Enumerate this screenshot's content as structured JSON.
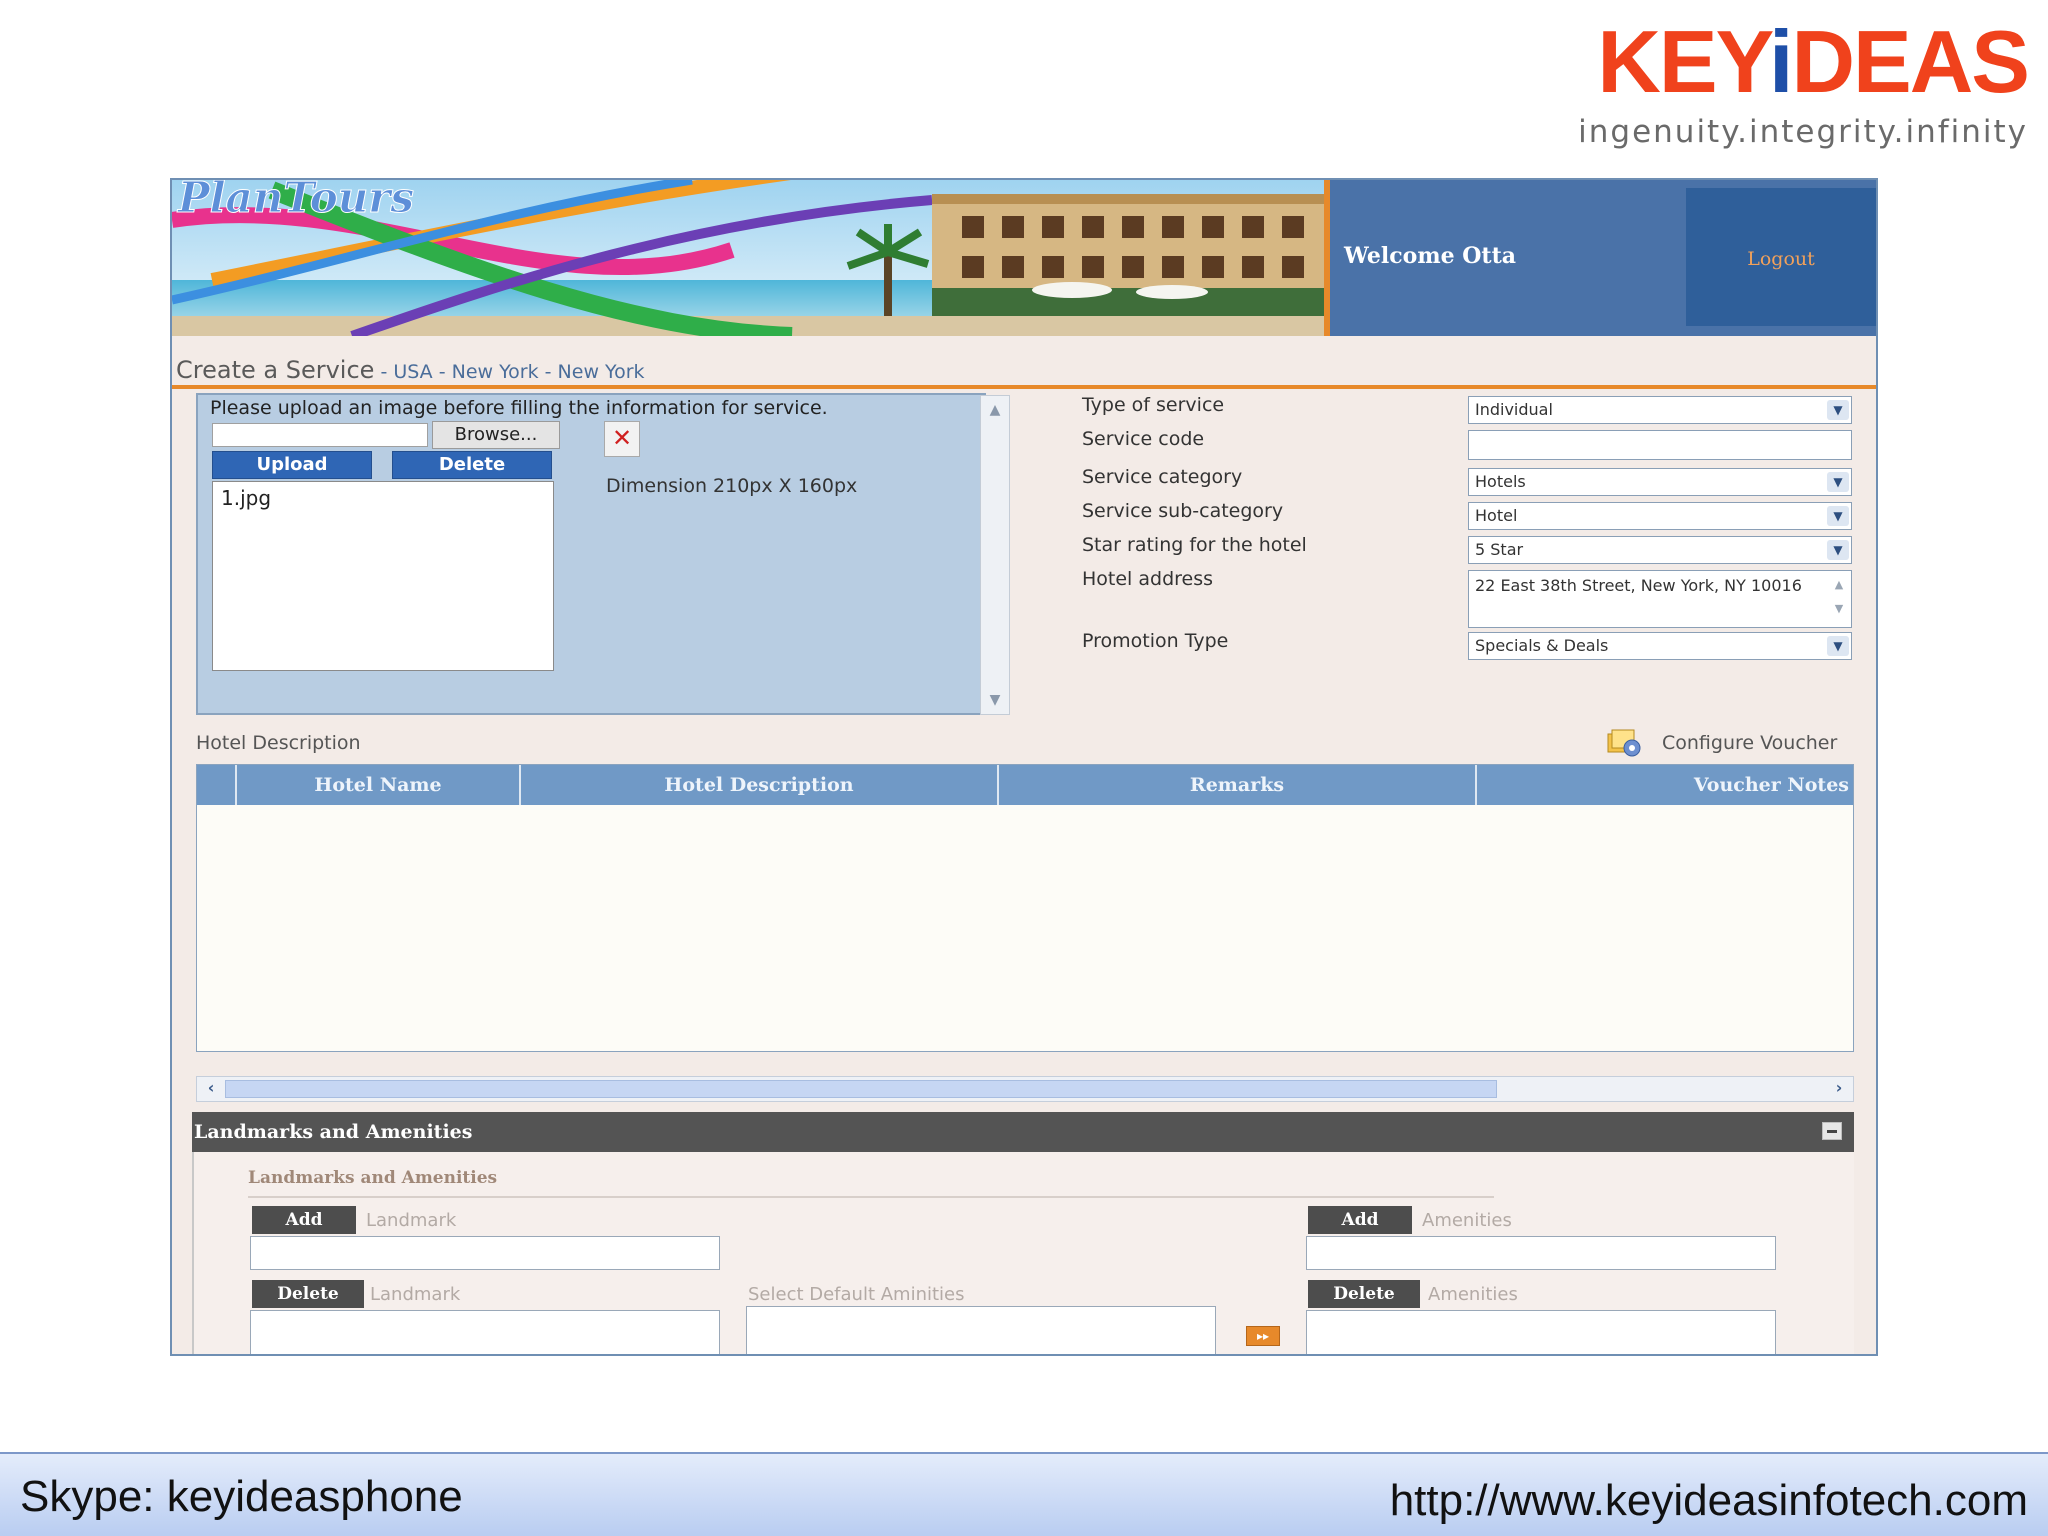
{
  "brand": {
    "name_prefix": "KEY",
    "name_i": "i",
    "name_suffix": "DEAS",
    "tagline": "ingenuity.integrity.infinity"
  },
  "header": {
    "banner_logo": "PlanTours",
    "welcome": "Welcome Otta",
    "logout": "Logout"
  },
  "page": {
    "title": "Create a Service",
    "breadcrumb": " - USA - New York - New York"
  },
  "upload": {
    "message": "Please upload an image before filling the information for service.",
    "browse": "Browse...",
    "upload_button": "Upload",
    "delete_button": "Delete",
    "files": [
      "1.jpg"
    ],
    "dimension": "Dimension 210px X 160px"
  },
  "form": {
    "type_label": "Type of service",
    "type_value": "Individual",
    "code_label": "Service code",
    "code_value": "",
    "category_label": "Service category",
    "category_value": "Hotels",
    "subcategory_label": "Service sub-category",
    "subcategory_value": "Hotel",
    "star_label": "Star rating for the hotel",
    "star_value": "5 Star",
    "address_label": "Hotel address",
    "address_value": "22 East 38th Street, New York, NY 10016",
    "promotion_label": "Promotion Type",
    "promotion_value": "Specials & Deals"
  },
  "hotel_description": {
    "label": "Hotel Description",
    "configure_voucher": "Configure Voucher",
    "columns": [
      "Hotel Name",
      "Hotel Description",
      "Remarks",
      "Voucher Notes"
    ]
  },
  "landmarks": {
    "bar_title": "Landmarks and Amenities",
    "subtitle": "Landmarks and Amenities",
    "add": "Add",
    "delete": "Delete",
    "landmark": "Landmark",
    "amenities": "Amenities",
    "select_default": "Select Default Aminities"
  },
  "footer": {
    "skype": "Skype: keyideasphone",
    "url": "http://www.keyideasinfotech.com"
  },
  "colors": {
    "brand_orange": "#f0421c",
    "brand_blue": "#1e4fa8",
    "header_blue": "#4a72a8",
    "accent_orange": "#e7892a",
    "grid_header": "#7099c6",
    "panel_blue": "#b8cde2"
  }
}
